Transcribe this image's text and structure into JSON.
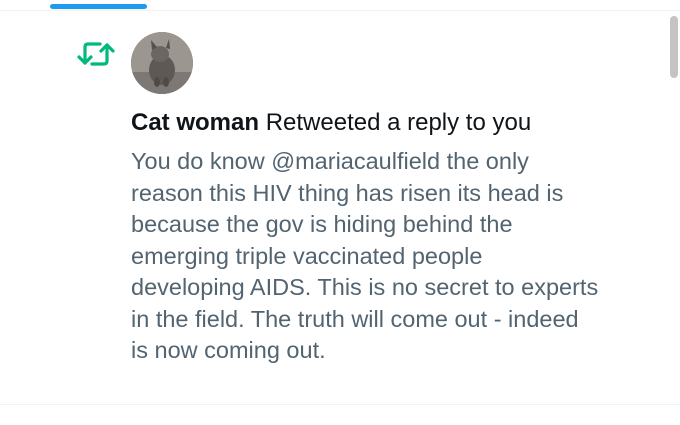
{
  "notification": {
    "user_name": "Cat woman",
    "action_text": "Retweeted a reply to you",
    "body_lines": [
      "You do know @mariacaulfield the only",
      "reason this HIV thing has risen its head is",
      "because the gov is hiding behind the",
      "emerging triple vaccinated people",
      "developing AIDS. This is no secret to experts",
      "in the field. The truth will come out - indeed",
      "is now coming out."
    ]
  },
  "colors": {
    "retweet_green": "#00ba7c",
    "accent_blue": "#1d9bf0",
    "text_primary": "#0f1419",
    "text_secondary": "#536471"
  },
  "icons": {
    "retweet": "retweet-icon",
    "avatar": "avatar"
  }
}
